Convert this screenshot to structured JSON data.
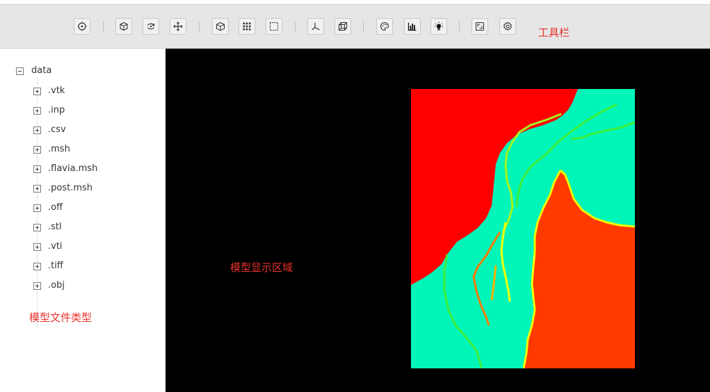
{
  "toolbar": {
    "note": "工具栏",
    "buttons": [
      {
        "icon": "target-icon"
      },
      {
        "icon": "reset-camera-icon"
      },
      {
        "icon": "rotate-icon"
      },
      {
        "icon": "pan-move-icon"
      },
      {
        "icon": "cube-view-icon"
      },
      {
        "icon": "grid-icon"
      },
      {
        "icon": "box-select-icon"
      },
      {
        "icon": "axes-icon"
      },
      {
        "icon": "wireframe-box-icon"
      },
      {
        "icon": "palette-icon"
      },
      {
        "icon": "bar-chart-icon"
      },
      {
        "icon": "light-bulb-icon"
      },
      {
        "icon": "fullscreen-icon"
      },
      {
        "icon": "settings-icon"
      }
    ]
  },
  "tree": {
    "root_label": "data",
    "items": [
      ".vtk",
      ".inp",
      ".csv",
      ".msh",
      ".flavia.msh",
      ".post.msh",
      ".off",
      ".stl",
      ".vti",
      ".tiff",
      ".obj"
    ],
    "note": "模型文件类型"
  },
  "viewport": {
    "note": "模型显示区域",
    "background": "#000000",
    "colors": {
      "red": "#ff0000",
      "orange_red": "#ff3a00",
      "cyan": "#00f5b8",
      "green": "#3ef03a",
      "yellow": "#f2ff00",
      "orange": "#ff7a00"
    }
  },
  "colors": {
    "annotation": "#e8322c",
    "toolbar_bg": "#e6e6e6"
  }
}
